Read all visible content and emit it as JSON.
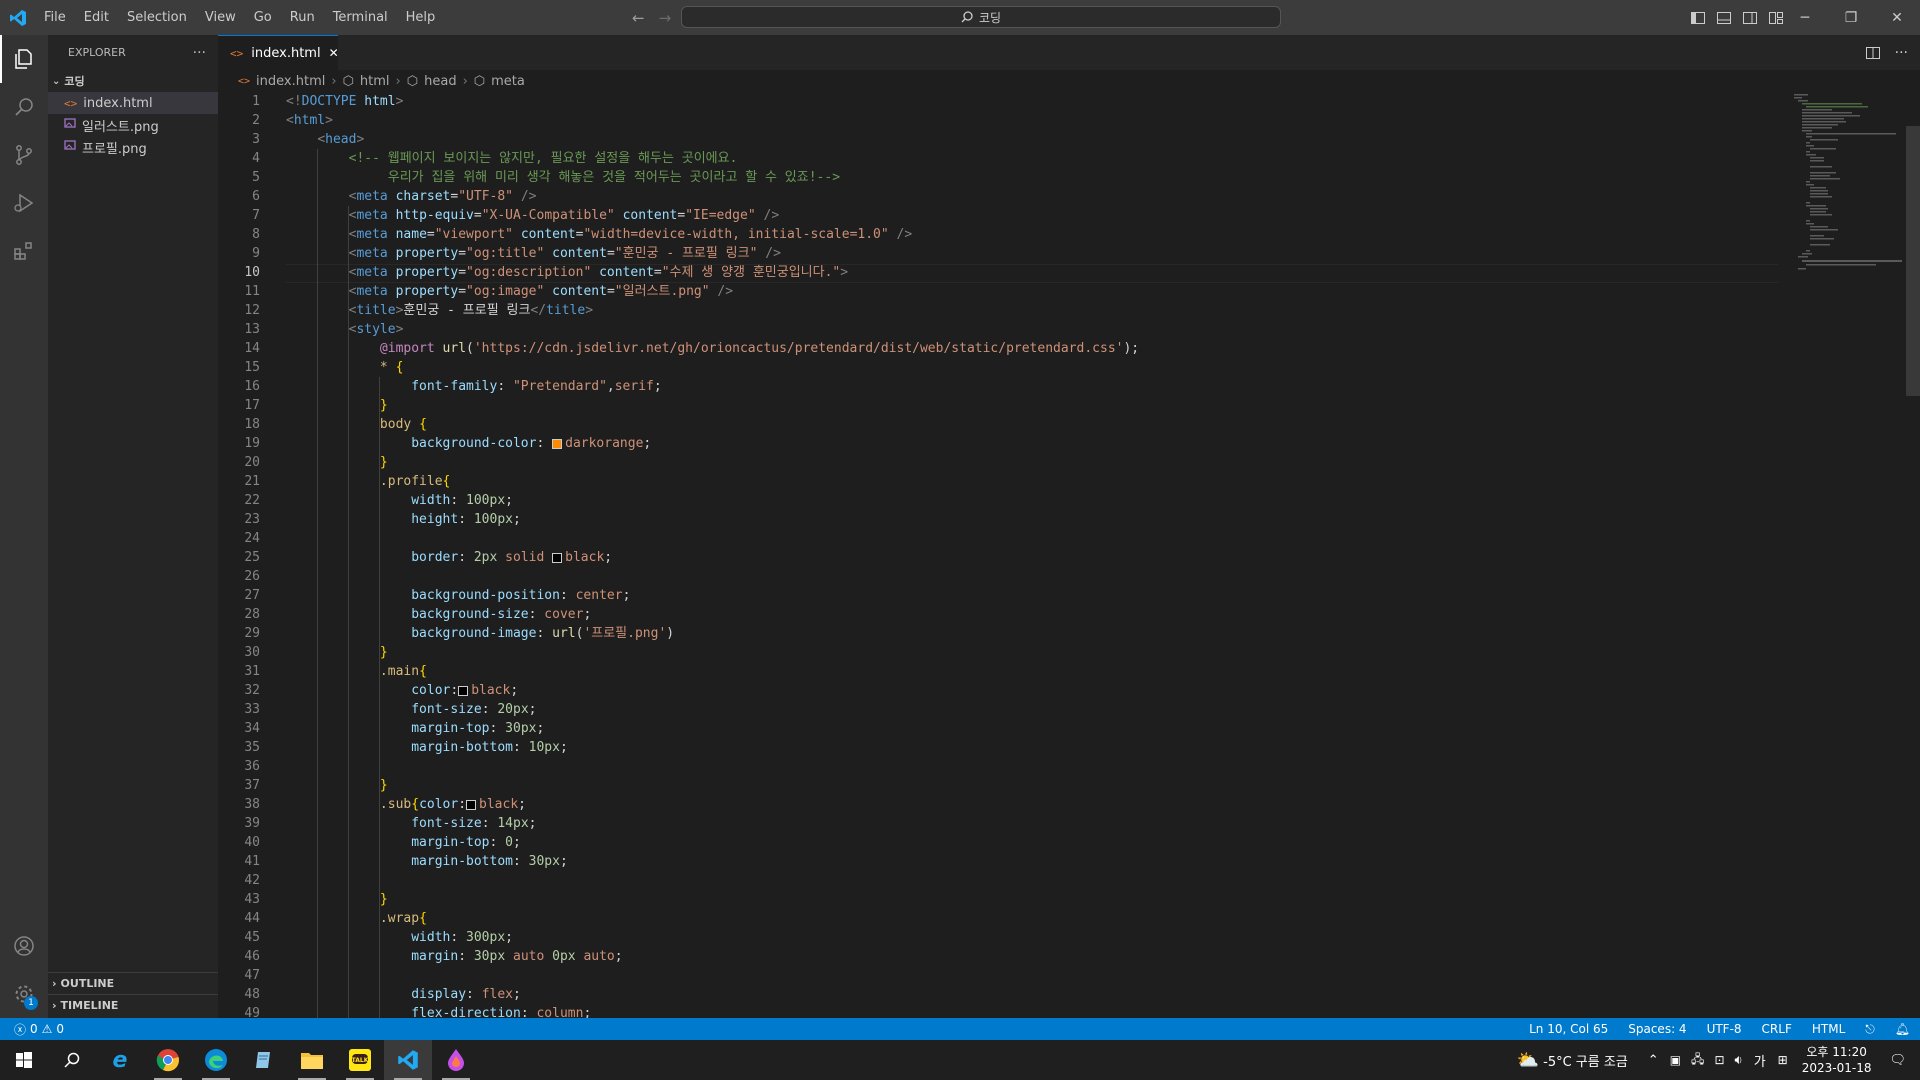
{
  "title_bar": {
    "menu": [
      "File",
      "Edit",
      "Selection",
      "View",
      "Go",
      "Run",
      "Terminal",
      "Help"
    ],
    "search_text": "코딩"
  },
  "sidebar": {
    "title": "EXPLORER",
    "more": "···",
    "folder": "코딩",
    "files": [
      {
        "name": "index.html",
        "icon": "html-file-icon",
        "selected": true
      },
      {
        "name": "일러스트.png",
        "icon": "image-file-icon",
        "selected": false
      },
      {
        "name": "프로필.png",
        "icon": "image-file-icon",
        "selected": false
      }
    ],
    "outline": "OUTLINE",
    "timeline": "TIMELINE"
  },
  "tabs": [
    {
      "label": "index.html",
      "active": true
    }
  ],
  "breadcrumbs": [
    "index.html",
    "html",
    "head",
    "meta"
  ],
  "editor": {
    "current_line": 10,
    "lines": [
      [
        [
          "t-brk",
          "<!"
        ],
        [
          "t-tag",
          "DOCTYPE"
        ],
        [
          "t-txt",
          " "
        ],
        [
          "t-attr",
          "html"
        ],
        [
          "t-brk",
          ">"
        ]
      ],
      [
        [
          "t-brk",
          "<"
        ],
        [
          "t-tag",
          "html"
        ],
        [
          "t-brk",
          ">"
        ]
      ],
      [
        [
          "t-txt",
          "    "
        ],
        [
          "t-brk",
          "<"
        ],
        [
          "t-tag",
          "head"
        ],
        [
          "t-brk",
          ">"
        ]
      ],
      [
        [
          "t-txt",
          "        "
        ],
        [
          "t-cmt",
          "<!-- 웹페이지 보이지는 않지만, 필요한 설정을 해두는 곳이에요."
        ]
      ],
      [
        [
          "t-txt",
          "             "
        ],
        [
          "t-cmt",
          "우리가 집을 위해 미리 생각 해놓은 것을 적어두는 곳이라고 할 수 있죠!-->"
        ]
      ],
      [
        [
          "t-txt",
          "        "
        ],
        [
          "t-brk",
          "<"
        ],
        [
          "t-tag",
          "meta"
        ],
        [
          "t-txt",
          " "
        ],
        [
          "t-attr",
          "charset"
        ],
        [
          "t-txt",
          "="
        ],
        [
          "t-str",
          "\"UTF-8\""
        ],
        [
          "t-txt",
          " "
        ],
        [
          "t-brk",
          "/>"
        ]
      ],
      [
        [
          "t-txt",
          "        "
        ],
        [
          "t-brk",
          "<"
        ],
        [
          "t-tag",
          "meta"
        ],
        [
          "t-txt",
          " "
        ],
        [
          "t-attr",
          "http-equiv"
        ],
        [
          "t-txt",
          "="
        ],
        [
          "t-str",
          "\"X-UA-Compatible\""
        ],
        [
          "t-txt",
          " "
        ],
        [
          "t-attr",
          "content"
        ],
        [
          "t-txt",
          "="
        ],
        [
          "t-str",
          "\"IE=edge\""
        ],
        [
          "t-txt",
          " "
        ],
        [
          "t-brk",
          "/>"
        ]
      ],
      [
        [
          "t-txt",
          "        "
        ],
        [
          "t-brk",
          "<"
        ],
        [
          "t-tag",
          "meta"
        ],
        [
          "t-txt",
          " "
        ],
        [
          "t-attr",
          "name"
        ],
        [
          "t-txt",
          "="
        ],
        [
          "t-str",
          "\"viewport\""
        ],
        [
          "t-txt",
          " "
        ],
        [
          "t-attr",
          "content"
        ],
        [
          "t-txt",
          "="
        ],
        [
          "t-str",
          "\"width=device-width, initial-scale=1.0\""
        ],
        [
          "t-txt",
          " "
        ],
        [
          "t-brk",
          "/>"
        ]
      ],
      [
        [
          "t-txt",
          "        "
        ],
        [
          "t-brk",
          "<"
        ],
        [
          "t-tag",
          "meta"
        ],
        [
          "t-txt",
          " "
        ],
        [
          "t-attr",
          "property"
        ],
        [
          "t-txt",
          "="
        ],
        [
          "t-str",
          "\"og:title\""
        ],
        [
          "t-txt",
          " "
        ],
        [
          "t-attr",
          "content"
        ],
        [
          "t-txt",
          "="
        ],
        [
          "t-str",
          "\"훈민궁 - 프로필 링크\""
        ],
        [
          "t-txt",
          " "
        ],
        [
          "t-brk",
          "/>"
        ]
      ],
      [
        [
          "t-txt",
          "        "
        ],
        [
          "t-brk",
          "<"
        ],
        [
          "t-tag",
          "meta"
        ],
        [
          "t-txt",
          " "
        ],
        [
          "t-attr",
          "property"
        ],
        [
          "t-txt",
          "="
        ],
        [
          "t-str",
          "\"og:description\""
        ],
        [
          "t-txt",
          " "
        ],
        [
          "t-attr",
          "content"
        ],
        [
          "t-txt",
          "="
        ],
        [
          "t-str",
          "\"수제 생 양갱 훈민궁입니다.\""
        ],
        [
          "t-brk",
          ">"
        ]
      ],
      [
        [
          "t-txt",
          "        "
        ],
        [
          "t-brk",
          "<"
        ],
        [
          "t-tag",
          "meta"
        ],
        [
          "t-txt",
          " "
        ],
        [
          "t-attr",
          "property"
        ],
        [
          "t-txt",
          "="
        ],
        [
          "t-str",
          "\"og:image\""
        ],
        [
          "t-txt",
          " "
        ],
        [
          "t-attr",
          "content"
        ],
        [
          "t-txt",
          "="
        ],
        [
          "t-str",
          "\"일러스트.png\""
        ],
        [
          "t-txt",
          " "
        ],
        [
          "t-brk",
          "/>"
        ]
      ],
      [
        [
          "t-txt",
          "        "
        ],
        [
          "t-brk",
          "<"
        ],
        [
          "t-tag",
          "title"
        ],
        [
          "t-brk",
          ">"
        ],
        [
          "t-txt",
          "훈민궁 - 프로필 링크"
        ],
        [
          "t-brk",
          "</"
        ],
        [
          "t-tag",
          "title"
        ],
        [
          "t-brk",
          ">"
        ]
      ],
      [
        [
          "t-txt",
          "        "
        ],
        [
          "t-brk",
          "<"
        ],
        [
          "t-tag",
          "style"
        ],
        [
          "t-brk",
          ">"
        ]
      ],
      [
        [
          "t-txt",
          "            "
        ],
        [
          "t-at",
          "@import"
        ],
        [
          "t-txt",
          " "
        ],
        [
          "t-fn",
          "url"
        ],
        [
          "t-txt",
          "("
        ],
        [
          "t-str",
          "'https://cdn.jsdelivr.net/gh/orioncactus/pretendard/dist/web/static/pretendard.css'"
        ],
        [
          "t-txt",
          ");"
        ]
      ],
      [
        [
          "t-txt",
          "            "
        ],
        [
          "t-sel",
          "*"
        ],
        [
          "t-txt",
          " "
        ],
        [
          "t-br",
          "{"
        ]
      ],
      [
        [
          "t-txt",
          "                "
        ],
        [
          "t-prop",
          "font-family"
        ],
        [
          "t-txt",
          ": "
        ],
        [
          "t-str",
          "\"Pretendard\""
        ],
        [
          "t-txt",
          ","
        ],
        [
          "t-str",
          "serif"
        ],
        [
          "t-txt",
          ";"
        ]
      ],
      [
        [
          "t-txt",
          "            "
        ],
        [
          "t-br",
          "}"
        ]
      ],
      [
        [
          "t-txt",
          "            "
        ],
        [
          "t-sel",
          "body"
        ],
        [
          "t-txt",
          " "
        ],
        [
          "t-br",
          "{"
        ]
      ],
      [
        [
          "t-txt",
          "                "
        ],
        [
          "t-prop",
          "background-color"
        ],
        [
          "t-txt",
          ": "
        ],
        [
          "swatch",
          "#ff8c00"
        ],
        [
          "t-str",
          "darkorange"
        ],
        [
          "t-txt",
          ";"
        ]
      ],
      [
        [
          "t-txt",
          "            "
        ],
        [
          "t-br",
          "}"
        ]
      ],
      [
        [
          "t-txt",
          "            "
        ],
        [
          "t-sel",
          ".profile"
        ],
        [
          "t-br",
          "{"
        ]
      ],
      [
        [
          "t-txt",
          "                "
        ],
        [
          "t-prop",
          "width"
        ],
        [
          "t-txt",
          ": "
        ],
        [
          "t-num",
          "100px"
        ],
        [
          "t-txt",
          ";"
        ]
      ],
      [
        [
          "t-txt",
          "                "
        ],
        [
          "t-prop",
          "height"
        ],
        [
          "t-txt",
          ": "
        ],
        [
          "t-num",
          "100px"
        ],
        [
          "t-txt",
          ";"
        ]
      ],
      [],
      [
        [
          "t-txt",
          "                "
        ],
        [
          "t-prop",
          "border"
        ],
        [
          "t-txt",
          ": "
        ],
        [
          "t-num",
          "2px"
        ],
        [
          "t-txt",
          " "
        ],
        [
          "t-str",
          "solid"
        ],
        [
          "t-txt",
          " "
        ],
        [
          "swatch",
          "#000000"
        ],
        [
          "t-str",
          "black"
        ],
        [
          "t-txt",
          ";"
        ]
      ],
      [],
      [
        [
          "t-txt",
          "                "
        ],
        [
          "t-prop",
          "background-position"
        ],
        [
          "t-txt",
          ": "
        ],
        [
          "t-str",
          "center"
        ],
        [
          "t-txt",
          ";"
        ]
      ],
      [
        [
          "t-txt",
          "                "
        ],
        [
          "t-prop",
          "background-size"
        ],
        [
          "t-txt",
          ": "
        ],
        [
          "t-str",
          "cover"
        ],
        [
          "t-txt",
          ";"
        ]
      ],
      [
        [
          "t-txt",
          "                "
        ],
        [
          "t-prop",
          "background-image"
        ],
        [
          "t-txt",
          ": "
        ],
        [
          "t-fn",
          "url"
        ],
        [
          "t-txt",
          "("
        ],
        [
          "t-str",
          "'프로필.png'"
        ],
        [
          "t-txt",
          ")"
        ]
      ],
      [
        [
          "t-txt",
          "            "
        ],
        [
          "t-br",
          "}"
        ]
      ],
      [
        [
          "t-txt",
          "            "
        ],
        [
          "t-sel",
          ".main"
        ],
        [
          "t-br",
          "{"
        ]
      ],
      [
        [
          "t-txt",
          "                "
        ],
        [
          "t-prop",
          "color"
        ],
        [
          "t-txt",
          ":"
        ],
        [
          "swatch",
          "#000000"
        ],
        [
          "t-str",
          "black"
        ],
        [
          "t-txt",
          ";"
        ]
      ],
      [
        [
          "t-txt",
          "                "
        ],
        [
          "t-prop",
          "font-size"
        ],
        [
          "t-txt",
          ": "
        ],
        [
          "t-num",
          "20px"
        ],
        [
          "t-txt",
          ";"
        ]
      ],
      [
        [
          "t-txt",
          "                "
        ],
        [
          "t-prop",
          "margin-top"
        ],
        [
          "t-txt",
          ": "
        ],
        [
          "t-num",
          "30px"
        ],
        [
          "t-txt",
          ";"
        ]
      ],
      [
        [
          "t-txt",
          "                "
        ],
        [
          "t-prop",
          "margin-bottom"
        ],
        [
          "t-txt",
          ": "
        ],
        [
          "t-num",
          "10px"
        ],
        [
          "t-txt",
          ";"
        ]
      ],
      [],
      [
        [
          "t-txt",
          "            "
        ],
        [
          "t-br",
          "}"
        ]
      ],
      [
        [
          "t-txt",
          "            "
        ],
        [
          "t-sel",
          ".sub"
        ],
        [
          "t-br",
          "{"
        ],
        [
          "t-prop",
          "color"
        ],
        [
          "t-txt",
          ":"
        ],
        [
          "swatch",
          "#000000"
        ],
        [
          "t-str",
          "black"
        ],
        [
          "t-txt",
          ";"
        ]
      ],
      [
        [
          "t-txt",
          "                "
        ],
        [
          "t-prop",
          "font-size"
        ],
        [
          "t-txt",
          ": "
        ],
        [
          "t-num",
          "14px"
        ],
        [
          "t-txt",
          ";"
        ]
      ],
      [
        [
          "t-txt",
          "                "
        ],
        [
          "t-prop",
          "margin-top"
        ],
        [
          "t-txt",
          ": "
        ],
        [
          "t-num",
          "0"
        ],
        [
          "t-txt",
          ";"
        ]
      ],
      [
        [
          "t-txt",
          "                "
        ],
        [
          "t-prop",
          "margin-bottom"
        ],
        [
          "t-txt",
          ": "
        ],
        [
          "t-num",
          "30px"
        ],
        [
          "t-txt",
          ";"
        ]
      ],
      [],
      [
        [
          "t-txt",
          "            "
        ],
        [
          "t-br",
          "}"
        ]
      ],
      [
        [
          "t-txt",
          "            "
        ],
        [
          "t-sel",
          ".wrap"
        ],
        [
          "t-br",
          "{"
        ]
      ],
      [
        [
          "t-txt",
          "                "
        ],
        [
          "t-prop",
          "width"
        ],
        [
          "t-txt",
          ": "
        ],
        [
          "t-num",
          "300px"
        ],
        [
          "t-txt",
          ";"
        ]
      ],
      [
        [
          "t-txt",
          "                "
        ],
        [
          "t-prop",
          "margin"
        ],
        [
          "t-txt",
          ": "
        ],
        [
          "t-num",
          "30px"
        ],
        [
          "t-txt",
          " "
        ],
        [
          "t-str",
          "auto"
        ],
        [
          "t-txt",
          " "
        ],
        [
          "t-num",
          "0px"
        ],
        [
          "t-txt",
          " "
        ],
        [
          "t-str",
          "auto"
        ],
        [
          "t-txt",
          ";"
        ]
      ],
      [],
      [
        [
          "t-txt",
          "                "
        ],
        [
          "t-prop",
          "display"
        ],
        [
          "t-txt",
          ": "
        ],
        [
          "t-str",
          "flex"
        ],
        [
          "t-txt",
          ";"
        ]
      ],
      [
        [
          "t-txt",
          "                "
        ],
        [
          "t-prop",
          "flex-direction"
        ],
        [
          "t-txt",
          ": "
        ],
        [
          "t-str",
          "column"
        ],
        [
          "t-txt",
          ";"
        ]
      ]
    ]
  },
  "status_bar": {
    "errors": "0",
    "warnings": "0",
    "position": "Ln 10, Col 65",
    "spaces": "Spaces: 4",
    "encoding": "UTF-8",
    "eol": "CRLF",
    "language": "HTML"
  },
  "taskbar": {
    "weather": "-5°C  구름 조금",
    "ime": "가",
    "time": "오후 11:20",
    "date": "2023-01-18"
  },
  "activity_bar": {
    "settings_badge": "1"
  },
  "colors": {
    "accent": "#007acc",
    "editor_bg": "#1e1e1e",
    "sidebar_bg": "#252526"
  }
}
